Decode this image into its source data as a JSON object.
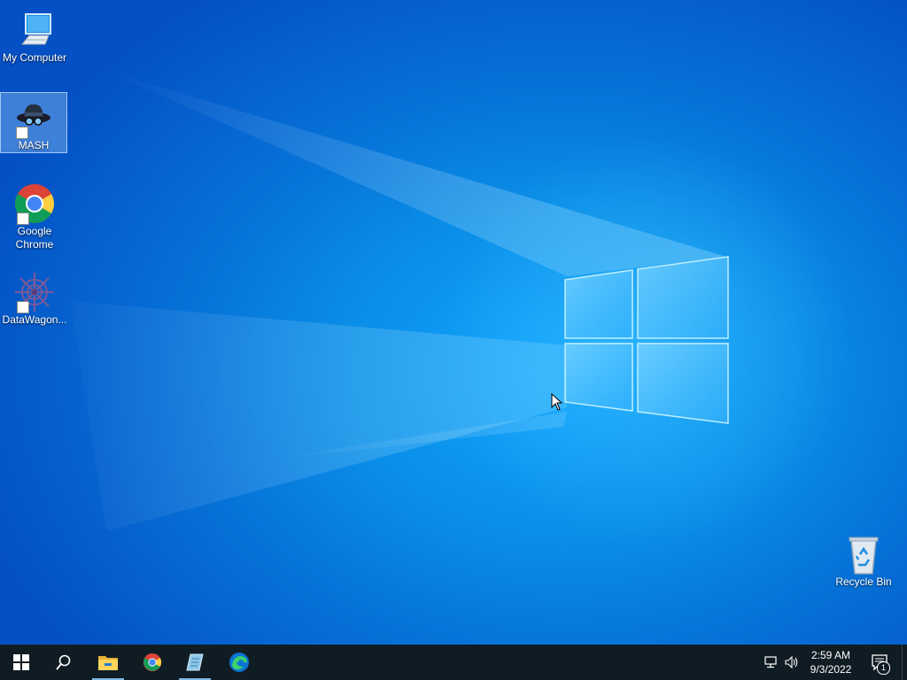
{
  "desktop": {
    "icons": [
      {
        "label": "My Computer",
        "icon": "computer-icon",
        "shortcut": false,
        "selected": false
      },
      {
        "label": "MASH",
        "icon": "spy-hat-icon",
        "shortcut": true,
        "selected": true
      },
      {
        "label": "Google Chrome",
        "icon": "chrome-icon",
        "shortcut": true,
        "selected": false
      },
      {
        "label": "DataWagon...",
        "icon": "datawagon-icon",
        "shortcut": true,
        "selected": false
      },
      {
        "label": "Recycle Bin",
        "icon": "recycle-bin-icon",
        "shortcut": false,
        "selected": false
      }
    ],
    "wallpaper": {
      "accent": "#0a8fe8",
      "logo": "windows-logo"
    }
  },
  "taskbar": {
    "background": "#101c24",
    "items": [
      {
        "name": "start",
        "icon": "windows-start-icon",
        "active": false
      },
      {
        "name": "search",
        "icon": "search-icon",
        "active": false
      },
      {
        "name": "file-explorer",
        "icon": "folder-icon",
        "active": true
      },
      {
        "name": "google-chrome",
        "icon": "chrome-icon",
        "active": false
      },
      {
        "name": "notepad-app",
        "icon": "notepad-icon",
        "active": true
      },
      {
        "name": "microsoft-edge",
        "icon": "edge-icon",
        "active": false
      }
    ],
    "tray": {
      "network_icon": "network-icon",
      "volume_icon": "speaker-icon",
      "time": "2:59 AM",
      "date": "9/3/2022",
      "notification_count": "1"
    }
  }
}
